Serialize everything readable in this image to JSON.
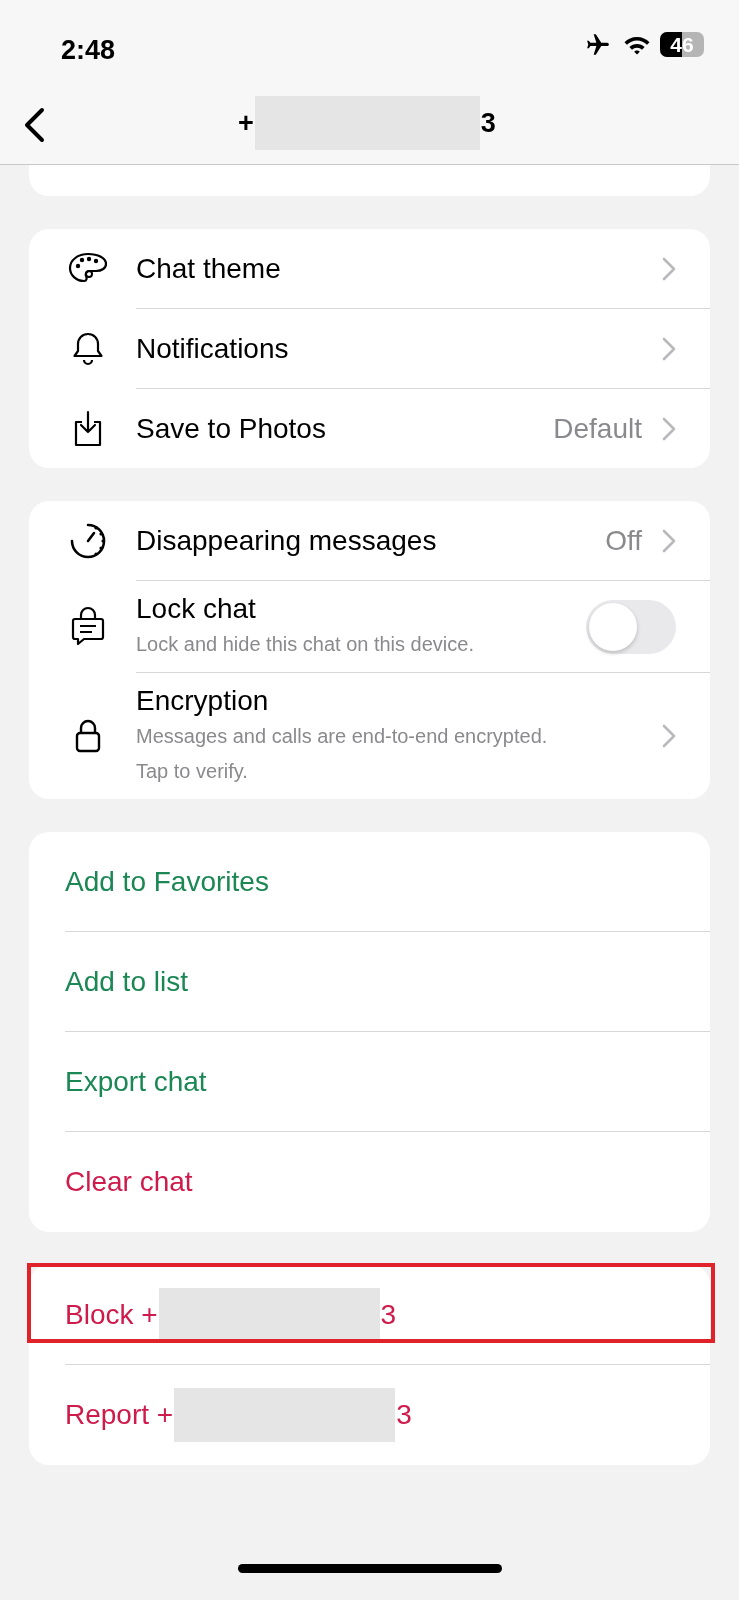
{
  "status_bar": {
    "time": "2:48",
    "battery": "46"
  },
  "header": {
    "title_prefix": "+",
    "title_suffix": "3"
  },
  "sections": [
    {
      "kind": "settings",
      "items": [
        {
          "kind": "link",
          "label": "Chat theme"
        },
        {
          "kind": "link",
          "label": "Notifications"
        },
        {
          "kind": "link",
          "label": "Save to Photos",
          "value": "Default"
        }
      ]
    },
    {
      "kind": "settings",
      "items": [
        {
          "kind": "link",
          "label": "Disappearing messages",
          "value": "Off"
        },
        {
          "kind": "toggle",
          "label": "Lock chat",
          "subtitle": "Lock and hide this chat on this device.",
          "on": false
        },
        {
          "kind": "link",
          "label": "Encryption",
          "subtitle": "Messages and calls are end-to-end encrypted. Tap to verify."
        }
      ]
    },
    {
      "kind": "actions",
      "items": [
        {
          "label": "Add to Favorites",
          "color": "#1b8754"
        },
        {
          "label": "Add to list",
          "color": "#1b8754"
        },
        {
          "label": "Export chat",
          "color": "#1b8754"
        },
        {
          "label": "Clear chat",
          "color": "#cf1a4c"
        }
      ]
    },
    {
      "kind": "actions",
      "items": [
        {
          "label": "Block +",
          "suffix": "3",
          "color": "#cf1a4c",
          "highlighted": true
        },
        {
          "label": "Report +",
          "suffix": "3",
          "color": "#cf1a4c",
          "highlighted": false
        }
      ]
    }
  ]
}
